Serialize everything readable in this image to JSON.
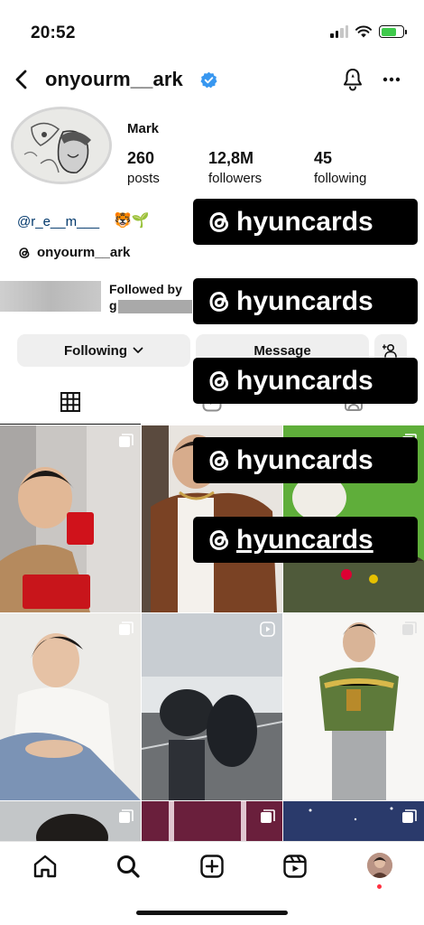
{
  "status_bar": {
    "time": "20:52"
  },
  "header": {
    "username": "onyourm__ark",
    "verified": true
  },
  "profile": {
    "display_name": "Mark",
    "stats": [
      {
        "value": "260",
        "label": "posts"
      },
      {
        "value": "12,8M",
        "label": "followers"
      },
      {
        "value": "45",
        "label": "following"
      }
    ],
    "bio_handle": "@r_e__m___",
    "bio_emoji": "🐯🌱",
    "threads_handle": "onyourm__ark",
    "followed_by_label": "Followed by",
    "followed_by_names": "g                    r"
  },
  "actions": {
    "following_label": "Following",
    "message_label": "Message"
  },
  "watermarks": [
    "hyuncards",
    "hyuncards",
    "hyuncards",
    "hyuncards",
    "hyuncards"
  ],
  "tabs": [
    {
      "icon": "grid-icon",
      "active": true
    },
    {
      "icon": "reels-icon",
      "active": false
    },
    {
      "icon": "tagged-icon",
      "active": false
    }
  ],
  "bottom_nav": [
    "home-icon",
    "search-icon",
    "create-icon",
    "reels-icon",
    "profile-avatar"
  ],
  "colors": {
    "link": "#00376b",
    "verified": "#3897f0",
    "button_bg": "#efefef",
    "watermark_bg": "#000000"
  }
}
